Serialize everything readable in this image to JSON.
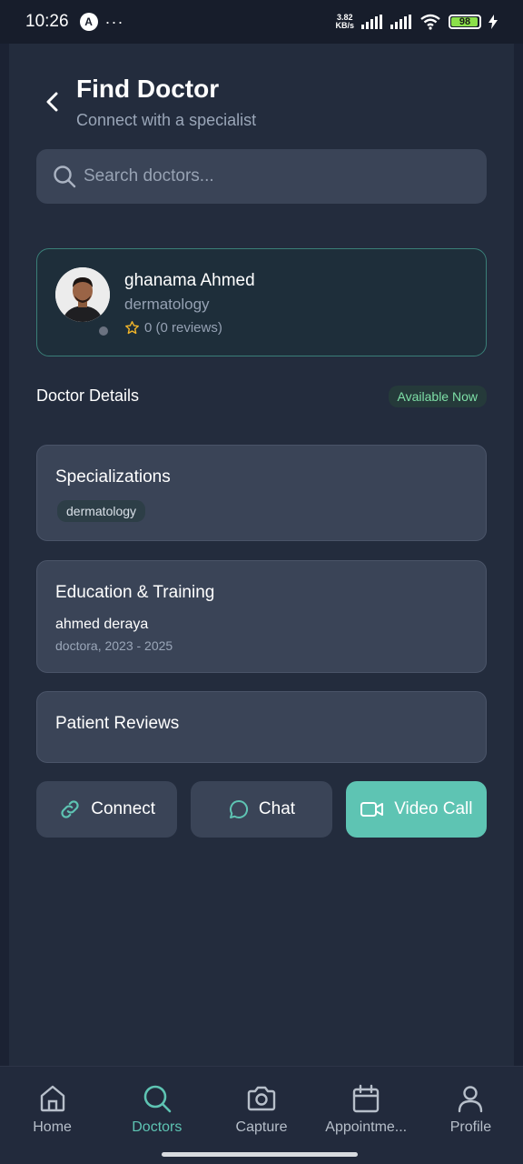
{
  "status_bar": {
    "time": "10:26",
    "app_icon": "A",
    "dots": "···",
    "net_speed_value": "3.82",
    "net_speed_unit": "KB/s",
    "battery": "98"
  },
  "header": {
    "title": "Find Doctor",
    "subtitle": "Connect with a specialist"
  },
  "search": {
    "placeholder": "Search doctors..."
  },
  "doctor": {
    "name": "ghanama Ahmed",
    "specialty": "dermatology",
    "rating_text": "0 (0 reviews)"
  },
  "details": {
    "heading": "Doctor Details",
    "availability": "Available Now"
  },
  "specializations": {
    "title": "Specializations",
    "chip": "dermatology"
  },
  "education": {
    "title": "Education & Training",
    "name": "ahmed deraya",
    "meta": "doctora, 2023 - 2025"
  },
  "reviews": {
    "title": "Patient Reviews"
  },
  "actions": {
    "connect": "Connect",
    "chat": "Chat",
    "video": "Video Call"
  },
  "nav": {
    "home": "Home",
    "doctors": "Doctors",
    "capture": "Capture",
    "appointments": "Appointme...",
    "profile": "Profile"
  },
  "colors": {
    "accent": "#5ec4b3",
    "background": "#232c3d",
    "card": "#3a4457",
    "available_text": "#7ee0a7",
    "star": "#f0b429"
  }
}
